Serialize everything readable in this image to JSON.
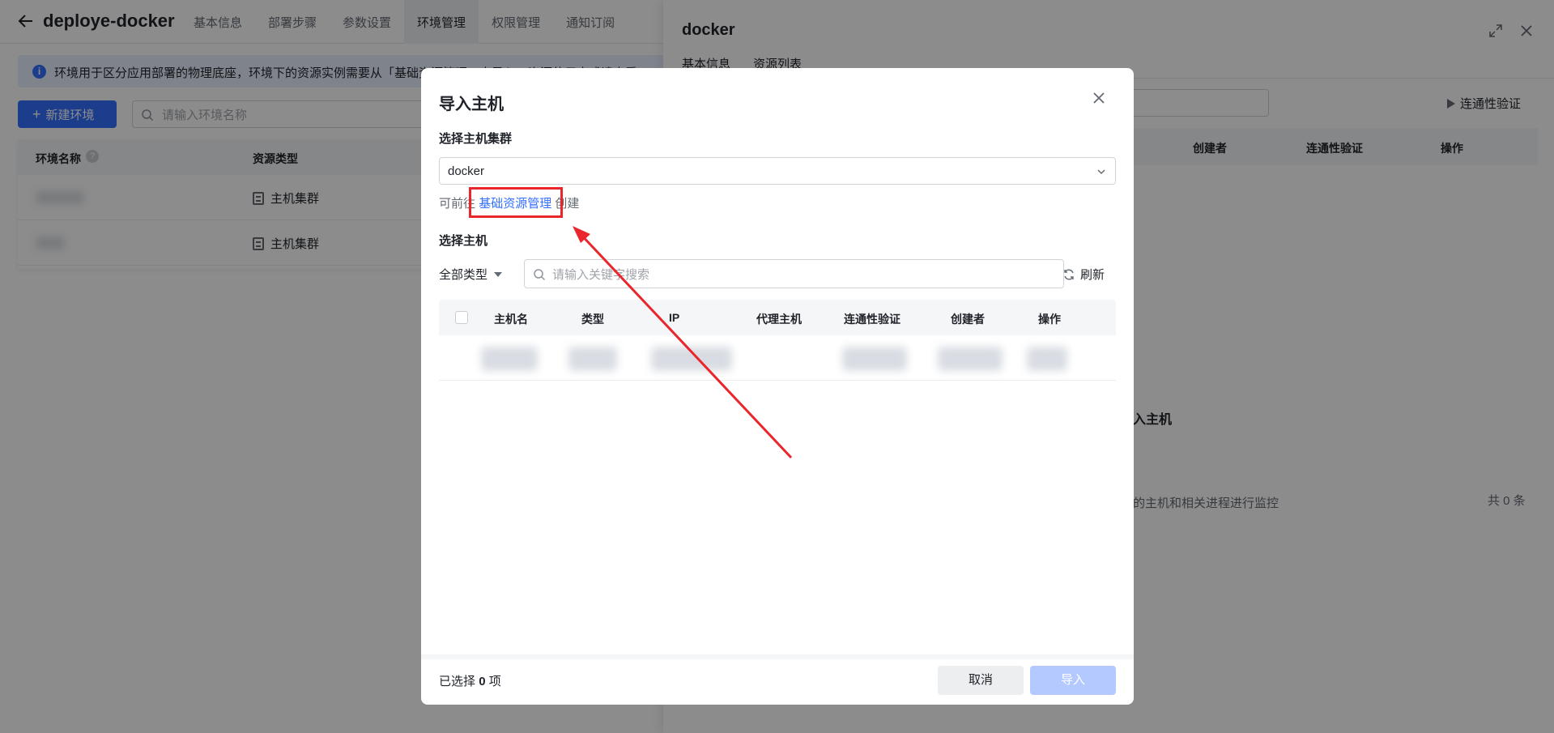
{
  "header": {
    "title": "deploye-docker",
    "tabs": [
      {
        "label": "基本信息"
      },
      {
        "label": "部署步骤"
      },
      {
        "label": "参数设置"
      },
      {
        "label": "环境管理"
      },
      {
        "label": "权限管理"
      },
      {
        "label": "通知订阅"
      }
    ],
    "active_tab": "环境管理"
  },
  "info_banner": {
    "text": "环境用于区分应用部署的物理底座，环境下的资源实例需要从「基础资源管理」中导入，资源使用方式请查看"
  },
  "env_toolbar": {
    "new_button_label": "新建环境",
    "search_placeholder": "请输入环境名称"
  },
  "env_table": {
    "columns": [
      "环境名称",
      "资源类型"
    ],
    "rows": [
      {
        "resource_type": "主机集群"
      },
      {
        "resource_type": "主机集群"
      }
    ]
  },
  "drawer": {
    "title": "docker",
    "tabs": [
      "基本信息",
      "资源列表"
    ],
    "verify_label": "连通性验证",
    "columns": [
      "创建者",
      "连通性验证",
      "操作"
    ],
    "empty_label": "入主机",
    "description": "的主机和相关进程进行监控",
    "total": "共 0 条"
  },
  "modal": {
    "title": "导入主机",
    "cluster_section_label": "选择主机集群",
    "cluster_value": "docker",
    "hint_prefix": "可前往",
    "hint_link": "基础资源管理",
    "hint_suffix": "创建",
    "host_section_label": "选择主机",
    "type_filter": "全部类型",
    "search_placeholder": "请输入关键字搜索",
    "refresh_label": "刷新",
    "columns": [
      "主机名",
      "类型",
      "IP",
      "代理主机",
      "连通性验证",
      "创建者",
      "操作"
    ],
    "footer": {
      "selected_prefix": "已选择",
      "selected_count": "0",
      "selected_suffix": "项",
      "cancel_label": "取消",
      "import_label": "导入"
    }
  },
  "colors": {
    "primary": "#3370ff",
    "annotation_red": "#e8262b",
    "disabled_primary": "#b3c9ff"
  },
  "icons": [
    "back-arrow-icon",
    "info-icon",
    "plus-icon",
    "search-icon",
    "help-icon",
    "cluster-icon",
    "expand-icon",
    "close-icon",
    "play-icon",
    "chevron-down-icon",
    "caret-down-icon",
    "refresh-icon"
  ]
}
